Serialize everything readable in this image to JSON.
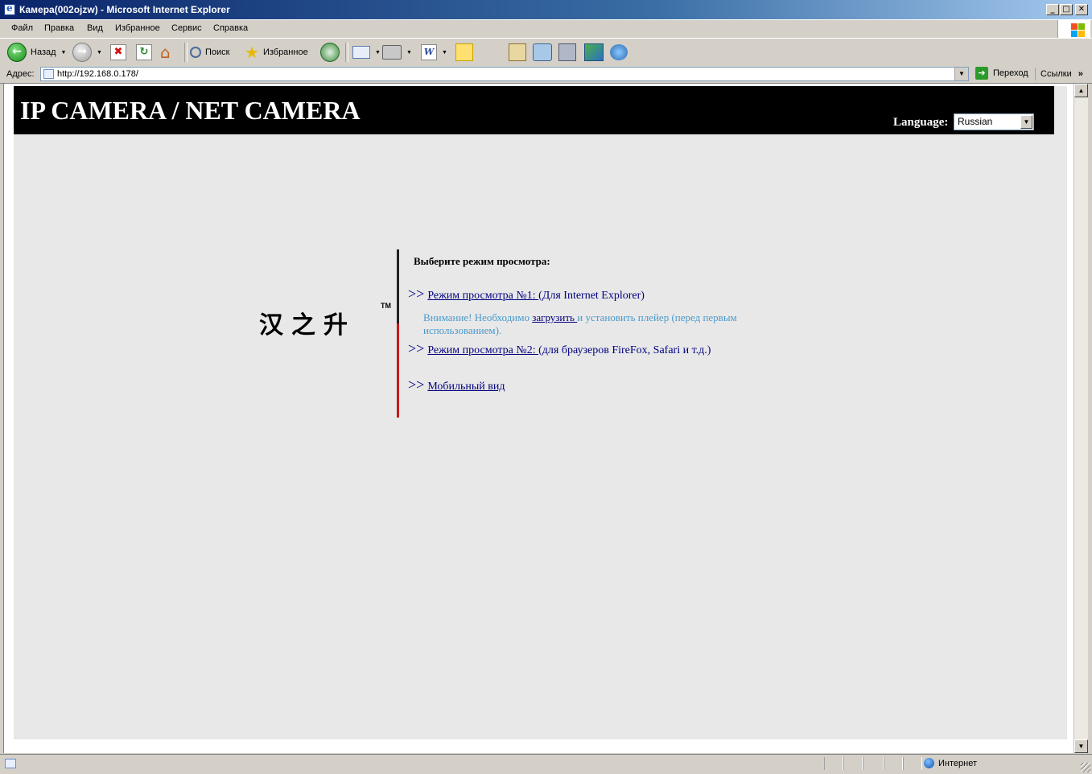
{
  "window": {
    "title": "Камера(002ojzw) - Microsoft Internet Explorer",
    "minimize": "_",
    "maximize": "□",
    "close": "✕"
  },
  "menu": {
    "items": [
      "Файл",
      "Правка",
      "Вид",
      "Избранное",
      "Сервис",
      "Справка"
    ]
  },
  "toolbar": {
    "back_label": "Назад",
    "search_label": "Поиск",
    "favorites_label": "Избранное"
  },
  "address": {
    "label": "Адрес:",
    "url": "http://192.168.0.178/",
    "go_label": "Переход",
    "links_label": "Ссылки",
    "links_chevron": "»"
  },
  "page": {
    "header_title": "IP CAMERA / NET CAMERA",
    "language_label": "Language:",
    "language_value": "Russian",
    "logo_text": "汉之升",
    "logo_tm": "TM",
    "choose_heading": "Выберите режим просмотра:",
    "arrow": ">>",
    "mode1_link": "Режим просмотра №1: ",
    "mode1_suffix": "(Для Internet Explorer)",
    "notice_prefix": "Внимание! Необходимо ",
    "notice_link": "загрузить ",
    "notice_suffix": "и установить плейер (перед первым использованием).",
    "mode2_link": "Режим просмотра №2: ",
    "mode2_suffix": "(для браузеров FireFox, Safari и т.д.)",
    "mobile_link": "Мобильный вид"
  },
  "status": {
    "zone": "Интернет"
  },
  "colors": {
    "header_bg": "#000000",
    "page_bg": "#e8e8e8",
    "link": "#000080",
    "notice": "#4a9acb",
    "divider_red": "#c41a1a"
  }
}
